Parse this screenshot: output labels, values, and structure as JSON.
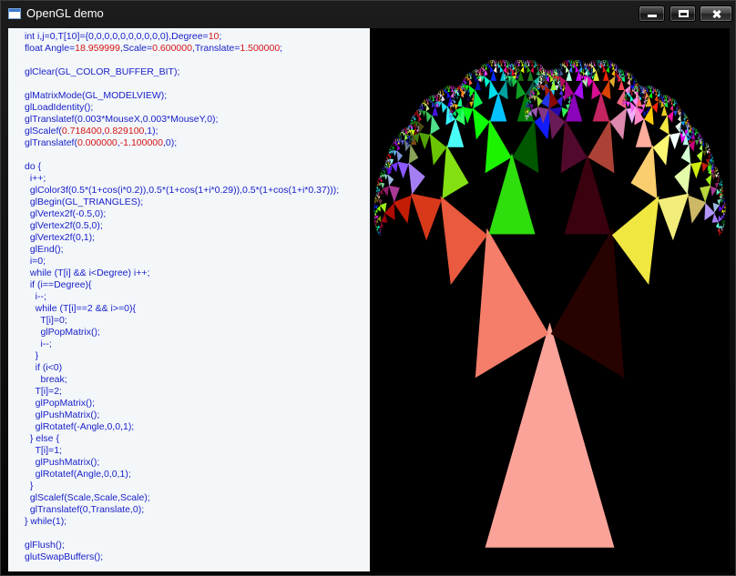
{
  "window": {
    "title": "OpenGL demo",
    "icon": "app-window-icon",
    "buttons": {
      "minimize": "minimize-icon",
      "maximize": "maximize-icon",
      "close": "close-icon"
    }
  },
  "code": {
    "lines": [
      [
        {
          "t": "int i,j=0,T[10]={0,0,0,0,0,0,0,0,0,0},Degree="
        },
        {
          "t": "10",
          "n": 1
        },
        {
          "t": ";"
        }
      ],
      [
        {
          "t": "float Angle="
        },
        {
          "t": "18.959999",
          "n": 1
        },
        {
          "t": ",Scale="
        },
        {
          "t": "0.600000",
          "n": 1
        },
        {
          "t": ",Translate="
        },
        {
          "t": "1.500000",
          "n": 1
        },
        {
          "t": ";"
        }
      ],
      [],
      [
        {
          "t": "glClear(GL_COLOR_BUFFER_BIT);"
        }
      ],
      [],
      [
        {
          "t": "glMatrixMode(GL_MODELVIEW);"
        }
      ],
      [
        {
          "t": "glLoadIdentity();"
        }
      ],
      [
        {
          "t": "glTranslatef(0.003*MouseX,0.003*MouseY,0);"
        }
      ],
      [
        {
          "t": "glScalef("
        },
        {
          "t": "0.718400",
          "n": 1
        },
        {
          "t": ","
        },
        {
          "t": "0.829100",
          "n": 1
        },
        {
          "t": ",1);"
        }
      ],
      [
        {
          "t": "glTranslatef("
        },
        {
          "t": "0.000000",
          "n": 1
        },
        {
          "t": ","
        },
        {
          "t": "-1.100000",
          "n": 1
        },
        {
          "t": ",0);"
        }
      ],
      [],
      [
        {
          "t": "do {"
        }
      ],
      [
        {
          "t": "  i++;"
        }
      ],
      [
        {
          "t": "  glColor3f(0.5*(1+cos(i*0.2)),0.5*(1+cos(1+i*0.29)),0.5*(1+cos(1+i*0.37)));"
        }
      ],
      [
        {
          "t": "  glBegin(GL_TRIANGLES);"
        }
      ],
      [
        {
          "t": "  glVertex2f(-0.5,0);"
        }
      ],
      [
        {
          "t": "  glVertex2f(0.5,0);"
        }
      ],
      [
        {
          "t": "  glVertex2f(0,1);"
        }
      ],
      [
        {
          "t": "  glEnd();"
        }
      ],
      [
        {
          "t": "  i=0;"
        }
      ],
      [
        {
          "t": "  while (T[i] && i<Degree) i++;"
        }
      ],
      [
        {
          "t": "  if (i==Degree){"
        }
      ],
      [
        {
          "t": "    i--;"
        }
      ],
      [
        {
          "t": "    while (T[i]==2 && i>=0){"
        }
      ],
      [
        {
          "t": "      T[i]=0;"
        }
      ],
      [
        {
          "t": "      glPopMatrix();"
        }
      ],
      [
        {
          "t": "      i--;"
        }
      ],
      [
        {
          "t": "    }"
        }
      ],
      [
        {
          "t": "    if (i<0)"
        }
      ],
      [
        {
          "t": "      break;"
        }
      ],
      [
        {
          "t": "    T[i]=2;"
        }
      ],
      [
        {
          "t": "    glPopMatrix();"
        }
      ],
      [
        {
          "t": "    glPushMatrix();"
        }
      ],
      [
        {
          "t": "    glRotatef(-Angle,0,0,1);"
        }
      ],
      [
        {
          "t": "  } else {"
        }
      ],
      [
        {
          "t": "    T[i]=1;"
        }
      ],
      [
        {
          "t": "    glPushMatrix();"
        }
      ],
      [
        {
          "t": "    glRotatef(Angle,0,0,1);"
        }
      ],
      [
        {
          "t": "  }"
        }
      ],
      [
        {
          "t": "  glScalef(Scale,Scale,Scale);"
        }
      ],
      [
        {
          "t": "  glTranslatef(0,Translate,0);"
        }
      ],
      [
        {
          "t": "} while(1);"
        }
      ],
      [],
      [
        {
          "t": "glFlush();"
        }
      ],
      [
        {
          "t": "glutSwapBuffers();"
        }
      ]
    ]
  },
  "render": {
    "angle": 18.959999,
    "scale": 0.6,
    "translate": 1.5,
    "degree": 10,
    "sx": 0.7184,
    "sy": 0.8291,
    "ty": -1.1,
    "background": "#000000"
  }
}
